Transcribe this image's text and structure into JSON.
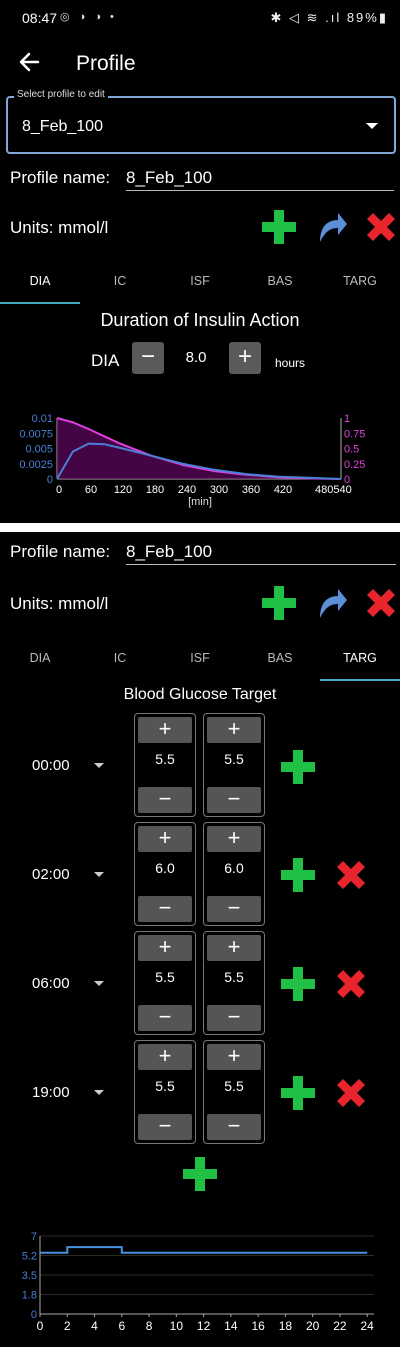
{
  "status_bar": {
    "time": "08:47",
    "icons": "◎ ◑ ◑ •",
    "right": "✱ ◁ ≋ .ıl 89%▮"
  },
  "header": {
    "title": "Profile"
  },
  "profile_select": {
    "label": "Select profile to edit",
    "value": "8_Feb_100"
  },
  "profile_name": {
    "label": "Profile name:",
    "value": "8_Feb_100"
  },
  "units": {
    "label": "Units: mmol/l"
  },
  "tabs": [
    "DIA",
    "IC",
    "ISF",
    "BAS",
    "TARG"
  ],
  "dia": {
    "title": "Duration of Insulin Action",
    "label": "DIA",
    "value": "8.0",
    "unit": "hours",
    "minus": "−",
    "plus": "+"
  },
  "chart_data": [
    {
      "type": "line",
      "xlabel": "[min]",
      "x_ticks": [
        "0",
        "60",
        "120",
        "180",
        "240",
        "300",
        "360",
        "420",
        "480540"
      ],
      "y_left_ticks": [
        "0",
        "0.0025",
        "0.005",
        "0.0075",
        "0.01"
      ],
      "y_right_ticks": [
        "0",
        "0.25",
        "0.5",
        "0.75",
        "1"
      ],
      "x": [
        0,
        30,
        60,
        90,
        120,
        180,
        240,
        300,
        360,
        420,
        480,
        540
      ],
      "series": [
        {
          "color": "#e040e0",
          "axis": "right",
          "values": [
            1.0,
            0.93,
            0.82,
            0.7,
            0.58,
            0.38,
            0.23,
            0.13,
            0.07,
            0.03,
            0.01,
            0.0
          ]
        },
        {
          "color": "#4a7fd6",
          "axis": "left",
          "values": [
            0.0,
            0.0045,
            0.0058,
            0.0057,
            0.0051,
            0.0038,
            0.0025,
            0.0015,
            0.0008,
            0.0004,
            0.0002,
            0.0
          ]
        }
      ],
      "ylim_left": [
        0,
        0.01
      ],
      "ylim_right": [
        0,
        1
      ],
      "xlim": [
        0,
        540
      ]
    },
    {
      "type": "line",
      "x_ticks": [
        "0",
        "2",
        "4",
        "6",
        "8",
        "10",
        "12",
        "14",
        "16",
        "18",
        "20",
        "22",
        "24"
      ],
      "y_ticks": [
        "0",
        "1.8",
        "3.5",
        "5.2",
        "7"
      ],
      "x": [
        0,
        2,
        2,
        6,
        6,
        24
      ],
      "series": [
        {
          "color": "#4a90e2",
          "values": [
            5.5,
            5.5,
            6.0,
            6.0,
            5.5,
            5.5
          ]
        }
      ],
      "xlim": [
        0,
        24.5
      ],
      "ylim": [
        0,
        7
      ]
    }
  ],
  "targ": {
    "title": "Blood Glucose Target",
    "rows": [
      {
        "time": "00:00",
        "low": "5.5",
        "high": "5.5"
      },
      {
        "time": "02:00",
        "low": "6.0",
        "high": "6.0"
      },
      {
        "time": "06:00",
        "low": "5.5",
        "high": "5.5"
      },
      {
        "time": "19:00",
        "low": "5.5",
        "high": "5.5"
      }
    ],
    "plus": "+",
    "minus": "−"
  },
  "colors": {
    "plus": "#1fc043",
    "delete": "#e8242c",
    "undo": "#5b8fd8",
    "tab_accent": "#41a8bd"
  }
}
